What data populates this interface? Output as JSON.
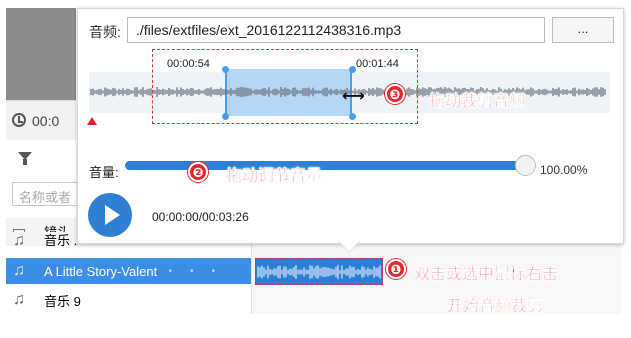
{
  "background": {
    "clock_text": "00:0",
    "search_placeholder": "名称或者",
    "rows": [
      {
        "icon": "video-icon",
        "label": "镜头"
      },
      {
        "icon": "music-note-icon",
        "label": "音乐 ."
      },
      {
        "icon": "music-note-icon",
        "label": "A Little Story-Valent"
      },
      {
        "icon": "music-note-icon",
        "label": "音乐 9"
      }
    ]
  },
  "popup": {
    "audio_label": "音频:",
    "audio_path": "./files/extfiles/ext_2016122112438316.mp3",
    "browse_label": "...",
    "trim_start": "00:00:54",
    "trim_end": "00:01:44",
    "volume_label": "音量:",
    "volume_value": "100.00%",
    "volume_level": 1.0,
    "time_readout": "00:00:00/00:03:26"
  },
  "callouts": [
    {
      "number": "❶",
      "text": "双击或选中鼠标右击"
    },
    {
      "number": "",
      "text": "开始音频裁剪"
    },
    {
      "number": "❷",
      "text": "拖动调节音量"
    },
    {
      "number": "❸",
      "text": "拖动裁剪音频"
    }
  ],
  "colors": {
    "accent": "#2f7fd2",
    "selection": "#b4d6f5",
    "callout_red": "#e8262b"
  }
}
